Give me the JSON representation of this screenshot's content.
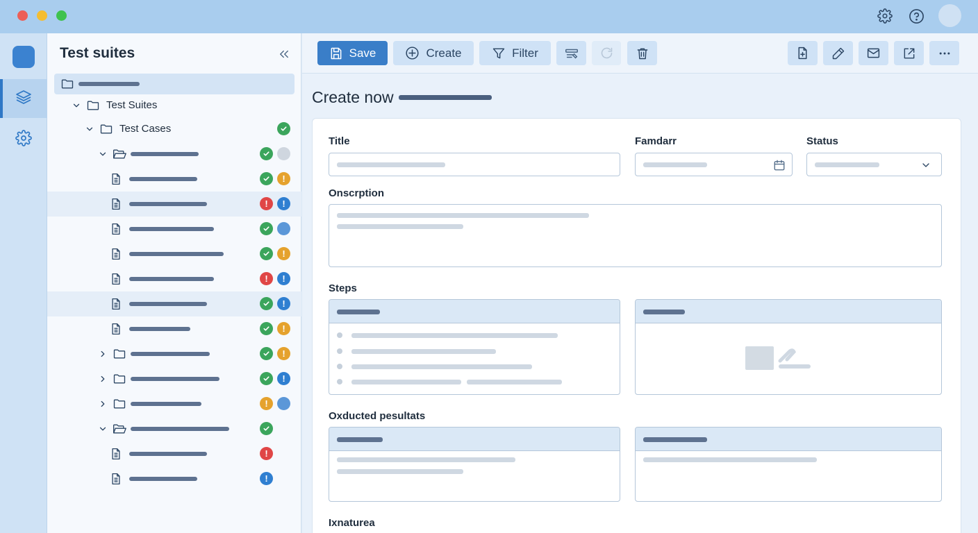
{
  "window": {
    "traffic_colors": [
      "#ec5f57",
      "#f4bd30",
      "#3fc24e"
    ]
  },
  "titlebar": {
    "icons": [
      "gear-icon",
      "help-circle-icon",
      "avatar"
    ]
  },
  "rail": {
    "items": [
      "layers-icon",
      "gear-icon"
    ]
  },
  "sidebar": {
    "title": "Test suites",
    "tree": [
      {
        "type": "folder",
        "selected": true,
        "label": ""
      },
      {
        "type": "folder",
        "expanded": true,
        "label": "Test Suites"
      },
      {
        "type": "folder",
        "expanded": true,
        "label": "Test Cases",
        "status": [
          "ok"
        ]
      },
      {
        "type": "folder-open",
        "expanded": true,
        "status": [
          "ok",
          "gray"
        ]
      },
      {
        "type": "file",
        "status": [
          "ok",
          "warn"
        ]
      },
      {
        "type": "file",
        "status": [
          "err",
          "info"
        ]
      },
      {
        "type": "file",
        "status": [
          "ok",
          "blue"
        ]
      },
      {
        "type": "file",
        "status": [
          "ok",
          "warn"
        ]
      },
      {
        "type": "file",
        "status": [
          "err",
          "info"
        ]
      },
      {
        "type": "file",
        "status": [
          "ok",
          "info"
        ]
      },
      {
        "type": "file",
        "status": [
          "ok",
          "warn"
        ]
      },
      {
        "type": "folder",
        "status": [
          "ok",
          "warn"
        ]
      },
      {
        "type": "folder",
        "status": [
          "ok",
          "info"
        ]
      },
      {
        "type": "folder",
        "status": [
          "warn",
          "blue"
        ]
      },
      {
        "type": "folder-open",
        "expanded": true,
        "status": [
          "ok"
        ]
      },
      {
        "type": "file",
        "status": [
          "err"
        ]
      },
      {
        "type": "file",
        "status": [
          "info"
        ]
      }
    ],
    "status_colors": {
      "ok": "#3ba55c",
      "warn": "#e5a22d",
      "err": "#e04646",
      "info": "#2f7fd1"
    }
  },
  "toolbar": {
    "save_label": "Save",
    "create_label": "Create",
    "filter_label": "Filter",
    "icons_left": [
      "batch-edit-icon",
      "refresh-icon",
      "trash-icon"
    ],
    "icons_right": [
      "new-file-icon",
      "pencil-icon",
      "mail-icon",
      "export-icon",
      "more-icon"
    ],
    "accent": "#3a7ec8"
  },
  "form": {
    "page_title": "Create now",
    "title_label": "Title",
    "date_label": "Famdarr",
    "status_label": "Status",
    "description_label": "Onscrption",
    "steps_label": "Steps",
    "expected_label": "Oxducted pesultats",
    "features_label": "Ixnaturea"
  }
}
